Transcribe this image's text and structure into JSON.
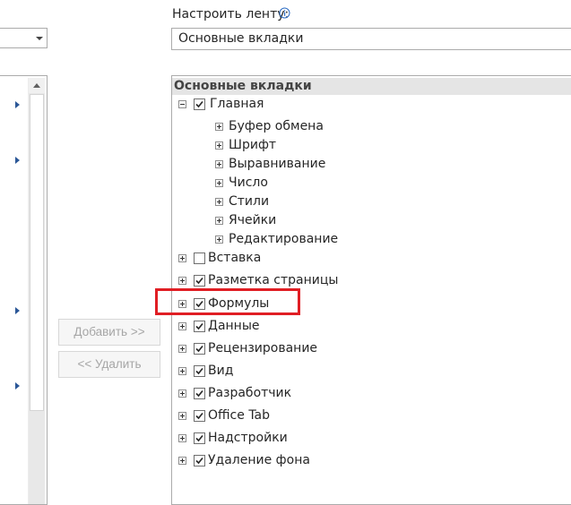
{
  "customize": {
    "label": "Настроить ленту:",
    "info_icon": "info-icon",
    "combo_value": "Основные вкладки"
  },
  "buttons": {
    "add": "Добавить >>",
    "remove": "<< Удалить"
  },
  "tree": {
    "header": "Основные вкладки",
    "root": {
      "label": "Главная",
      "expanded": true,
      "checked": true,
      "children": [
        "Буфер обмена",
        "Шрифт",
        "Выравнивание",
        "Число",
        "Стили",
        "Ячейки",
        "Редактирование"
      ]
    },
    "tabs": [
      {
        "label": "Вставка",
        "checked": false
      },
      {
        "label": "Разметка страницы",
        "checked": true
      },
      {
        "label": "Формулы",
        "checked": true
      },
      {
        "label": "Данные",
        "checked": true
      },
      {
        "label": "Рецензирование",
        "checked": true
      },
      {
        "label": "Вид",
        "checked": true
      },
      {
        "label": "Разработчик",
        "checked": true
      },
      {
        "label": "Office Tab",
        "checked": true
      },
      {
        "label": "Надстройки",
        "checked": true
      },
      {
        "label": "Удаление фона",
        "checked": true
      }
    ]
  },
  "colors": {
    "highlight": "#e01e24",
    "check": "#262626",
    "disabled_text": "#a6a6a6"
  }
}
